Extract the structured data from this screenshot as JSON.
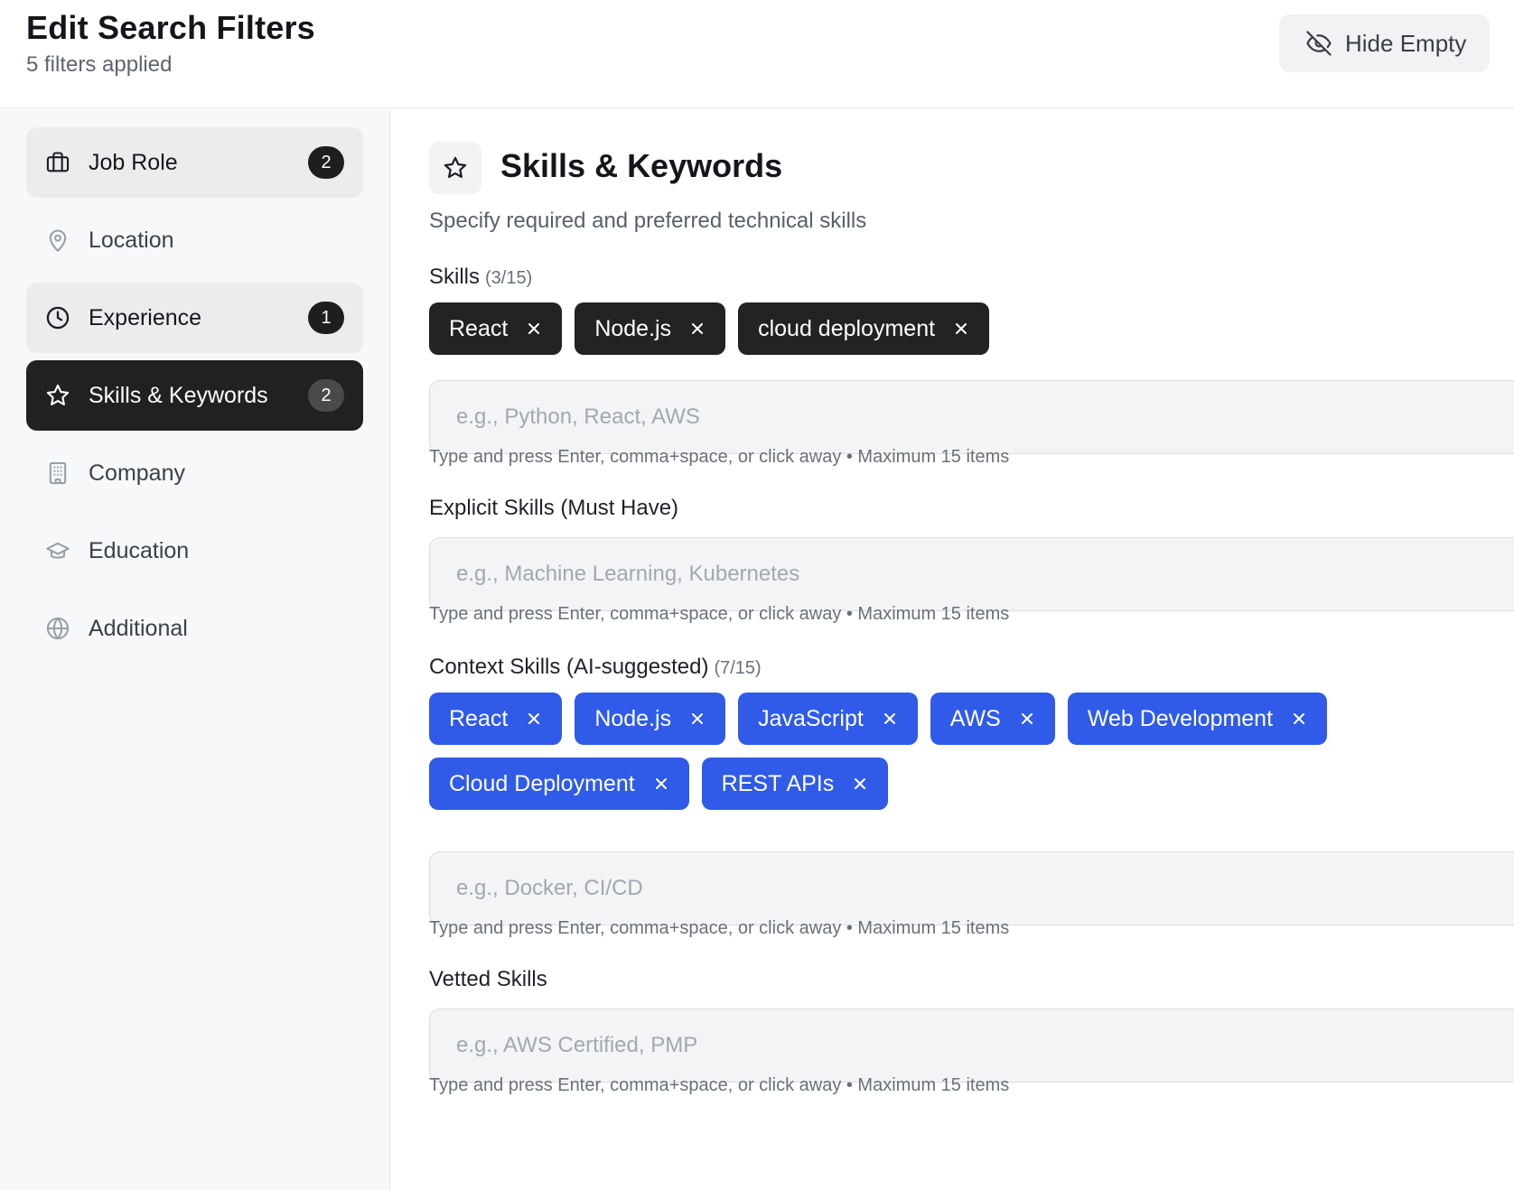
{
  "header": {
    "title": "Edit Search Filters",
    "subtitle": "5 filters applied",
    "hide_empty_label": "Hide Empty",
    "hide_empty_icon": "eye-off-icon"
  },
  "sidebar": {
    "items": [
      {
        "label": "Job Role",
        "icon": "briefcase-icon",
        "badge": "2",
        "state": "tinted"
      },
      {
        "label": "Location",
        "icon": "map-pin-icon",
        "badge": null,
        "state": "default"
      },
      {
        "label": "Experience",
        "icon": "clock-icon",
        "badge": "1",
        "state": "tinted"
      },
      {
        "label": "Skills & Keywords",
        "icon": "star-icon",
        "badge": "2",
        "state": "active"
      },
      {
        "label": "Company",
        "icon": "building-icon",
        "badge": null,
        "state": "default"
      },
      {
        "label": "Education",
        "icon": "graduation-cap-icon",
        "badge": null,
        "state": "default"
      },
      {
        "label": "Additional",
        "icon": "globe-icon",
        "badge": null,
        "state": "default"
      }
    ]
  },
  "main": {
    "section": {
      "icon": "star-icon",
      "title": "Skills & Keywords",
      "description": "Specify required and preferred technical skills"
    },
    "skills": {
      "label": "Skills",
      "count": "(3/15)",
      "chips": [
        "React",
        "Node.js",
        "cloud deployment"
      ],
      "placeholder": "e.g., Python, React, AWS",
      "hint": "Type and press Enter, comma+space, or click away • Maximum 15 items"
    },
    "explicit": {
      "label": "Explicit Skills (Must Have)",
      "placeholder": "e.g., Machine Learning, Kubernetes",
      "hint": "Type and press Enter, comma+space, or click away • Maximum 15 items"
    },
    "context": {
      "label": "Context Skills (AI-suggested)",
      "count": "(7/15)",
      "chips_row1": [
        "React",
        "Node.js",
        "JavaScript",
        "AWS",
        "Web Development"
      ],
      "chips_row2": [
        "Cloud Deployment",
        "REST APIs"
      ],
      "placeholder": "e.g., Docker, CI/CD",
      "hint": "Type and press Enter, comma+space, or click away • Maximum 15 items"
    },
    "vetted": {
      "label": "Vetted Skills",
      "placeholder": "e.g., AWS Certified, PMP",
      "hint": "Type and press Enter, comma+space, or click away • Maximum 15 items"
    }
  },
  "colors": {
    "dark_chip": "#232323",
    "blue_chip": "#2f5be8",
    "active_nav": "#212121"
  }
}
